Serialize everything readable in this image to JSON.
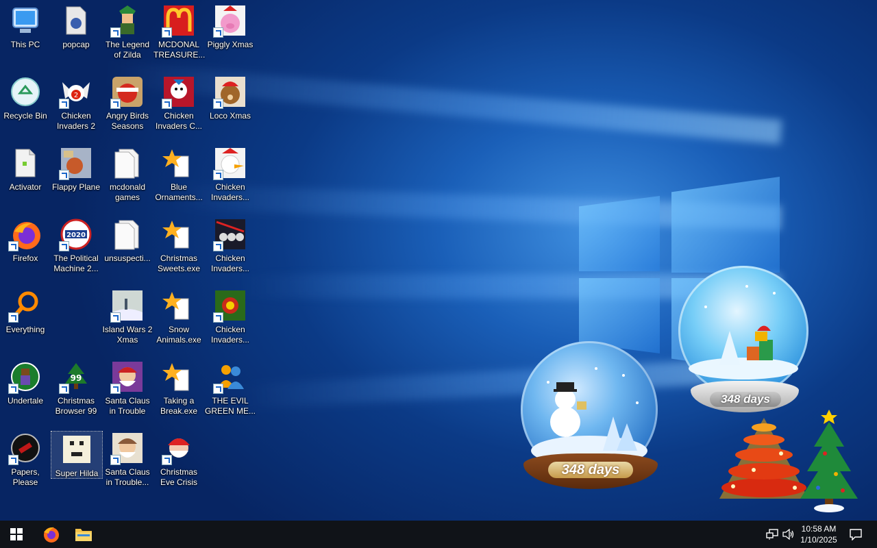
{
  "desktop": {
    "icons": [
      {
        "label": "This PC"
      },
      {
        "label": "Recycle Bin"
      },
      {
        "label": "Activator"
      },
      {
        "label": "Firefox"
      },
      {
        "label": "Everything"
      },
      {
        "label": "Undertale"
      },
      {
        "label": "Papers, Please"
      },
      {
        "label": "popcap"
      },
      {
        "label": "Chicken Invaders 2"
      },
      {
        "label": "Flappy Plane"
      },
      {
        "label": "The Political Machine 2..."
      },
      {
        "label": "Christmas Browser 99"
      },
      {
        "label": "Super Hilda"
      },
      {
        "label": "The Legend of Zilda"
      },
      {
        "label": "Angry Birds Seasons"
      },
      {
        "label": "mcdonald games"
      },
      {
        "label": "unsuspecti..."
      },
      {
        "label": "Island Wars 2 Xmas"
      },
      {
        "label": "Santa Claus in Trouble"
      },
      {
        "label": "Santa Claus in Trouble..."
      },
      {
        "label": "MCDONAL TREASURE..."
      },
      {
        "label": "Chicken Invaders C..."
      },
      {
        "label": "Blue Ornaments..."
      },
      {
        "label": "Christmas Sweets.exe"
      },
      {
        "label": "Snow Animals.exe"
      },
      {
        "label": "Taking a Break.exe"
      },
      {
        "label": "Christmas Eve Crisis"
      },
      {
        "label": "Piggly Xmas"
      },
      {
        "label": "Loco Xmas"
      },
      {
        "label": "Chicken Invaders..."
      },
      {
        "label": "Chicken Invaders..."
      },
      {
        "label": "Chicken Invaders..."
      },
      {
        "label": "THE EVIL GREEN ME..."
      }
    ]
  },
  "widgets": {
    "globe_left_label": "348 days",
    "globe_right_label": "348 days"
  },
  "taskbar": {
    "time": "10:58 AM",
    "date": "1/10/2025"
  },
  "colors": {
    "desktop_bg": "#0b3a86",
    "taskbar_bg": "#101318",
    "accent": "#3f8fe0"
  }
}
